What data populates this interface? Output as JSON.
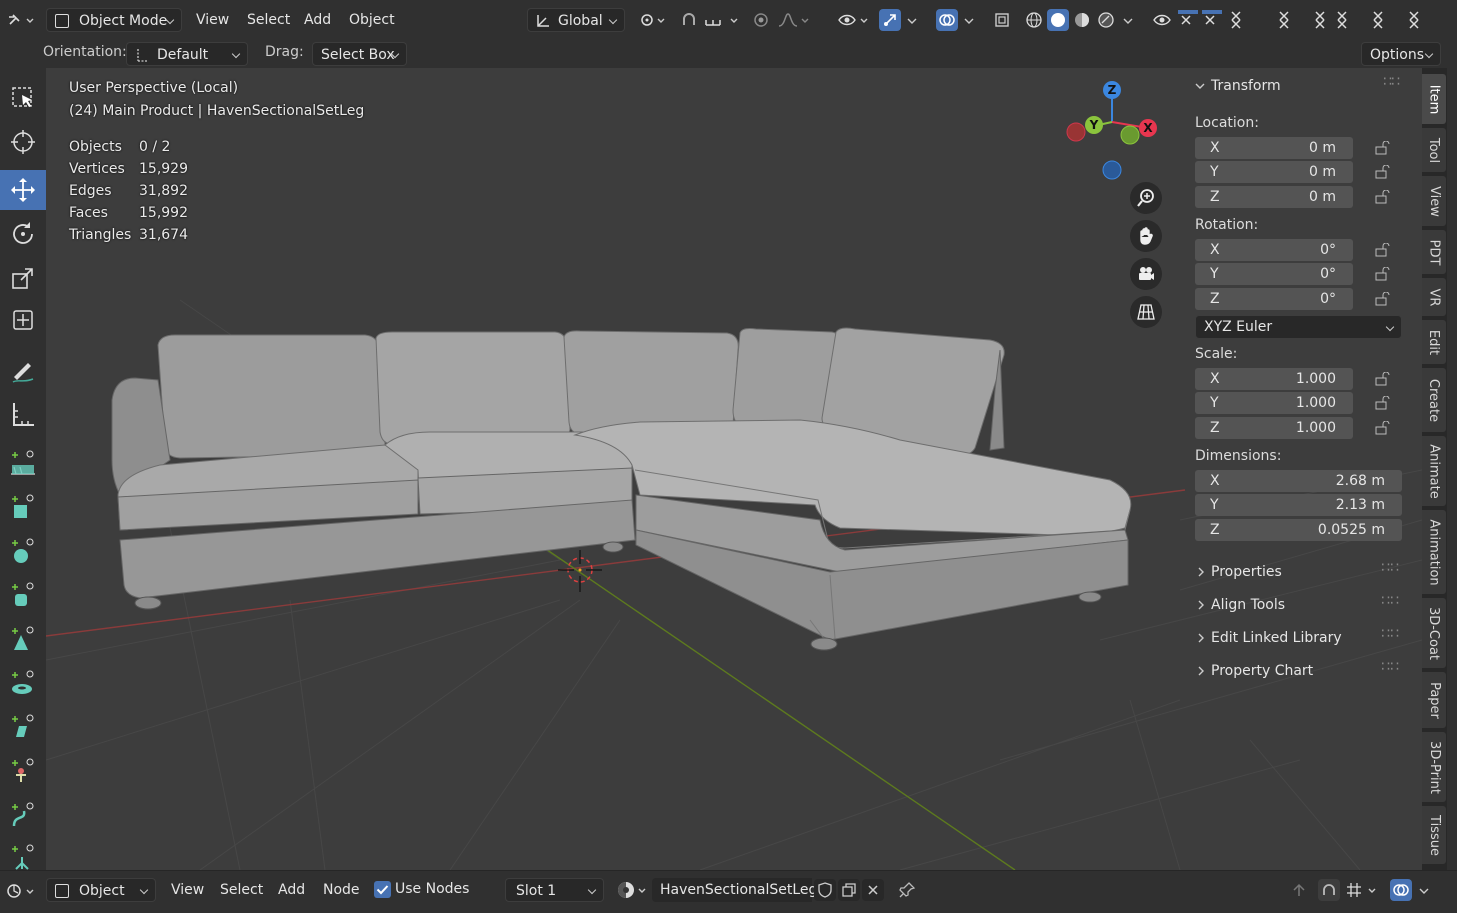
{
  "header": {
    "mode": "Object Mode",
    "menus": [
      "View",
      "Select",
      "Add",
      "Object"
    ],
    "transform_space": "Global"
  },
  "tool_settings": {
    "orientation_label": "Orientation:",
    "orientation_value": "Default",
    "drag_label": "Drag:",
    "drag_value": "Select Box",
    "options_label": "Options"
  },
  "viewport": {
    "view_name": "User Perspective (Local)",
    "object_info": "(24) Main Product | HavenSectionalSetLeg",
    "stats": [
      {
        "label": "Objects",
        "value": "0 / 2"
      },
      {
        "label": "Vertices",
        "value": "15,929"
      },
      {
        "label": "Edges",
        "value": "31,892"
      },
      {
        "label": "Faces",
        "value": "15,992"
      },
      {
        "label": "Triangles",
        "value": "31,674"
      }
    ],
    "gizmo_axes": {
      "z": "Z",
      "y": "Y",
      "x": "X"
    }
  },
  "npanel": {
    "transform_title": "Transform",
    "location_label": "Location:",
    "location": [
      {
        "axis": "X",
        "value": "0 m"
      },
      {
        "axis": "Y",
        "value": "0 m"
      },
      {
        "axis": "Z",
        "value": "0 m"
      }
    ],
    "rotation_label": "Rotation:",
    "rotation": [
      {
        "axis": "X",
        "value": "0°"
      },
      {
        "axis": "Y",
        "value": "0°"
      },
      {
        "axis": "Z",
        "value": "0°"
      }
    ],
    "rotation_mode": "XYZ Euler",
    "scale_label": "Scale:",
    "scale": [
      {
        "axis": "X",
        "value": "1.000"
      },
      {
        "axis": "Y",
        "value": "1.000"
      },
      {
        "axis": "Z",
        "value": "1.000"
      }
    ],
    "dimensions_label": "Dimensions:",
    "dimensions": [
      {
        "axis": "X",
        "value": "2.68 m"
      },
      {
        "axis": "Y",
        "value": "2.13 m"
      },
      {
        "axis": "Z",
        "value": "0.0525 m"
      }
    ],
    "collapsed_panels": [
      "Properties",
      "Align Tools",
      "Edit Linked Library",
      "Property Chart"
    ]
  },
  "side_tabs": [
    "Item",
    "Tool",
    "View",
    "PDT",
    "VR",
    "Edit",
    "Create",
    "Animate",
    "Animation",
    "3D-Coat",
    "Paper",
    "3D-Print",
    "Tissue"
  ],
  "bottom": {
    "object_selector": "Object",
    "menus": [
      "View",
      "Select",
      "Add",
      "Node"
    ],
    "use_nodes_label": "Use Nodes",
    "use_nodes_checked": true,
    "slot": "Slot 1",
    "material_name": "HavenSectionalSetLeg"
  },
  "colors": {
    "accent": "#4772b3",
    "axis_x": "#e8364f",
    "axis_y": "#8bc43d",
    "axis_z": "#3b87e0"
  }
}
